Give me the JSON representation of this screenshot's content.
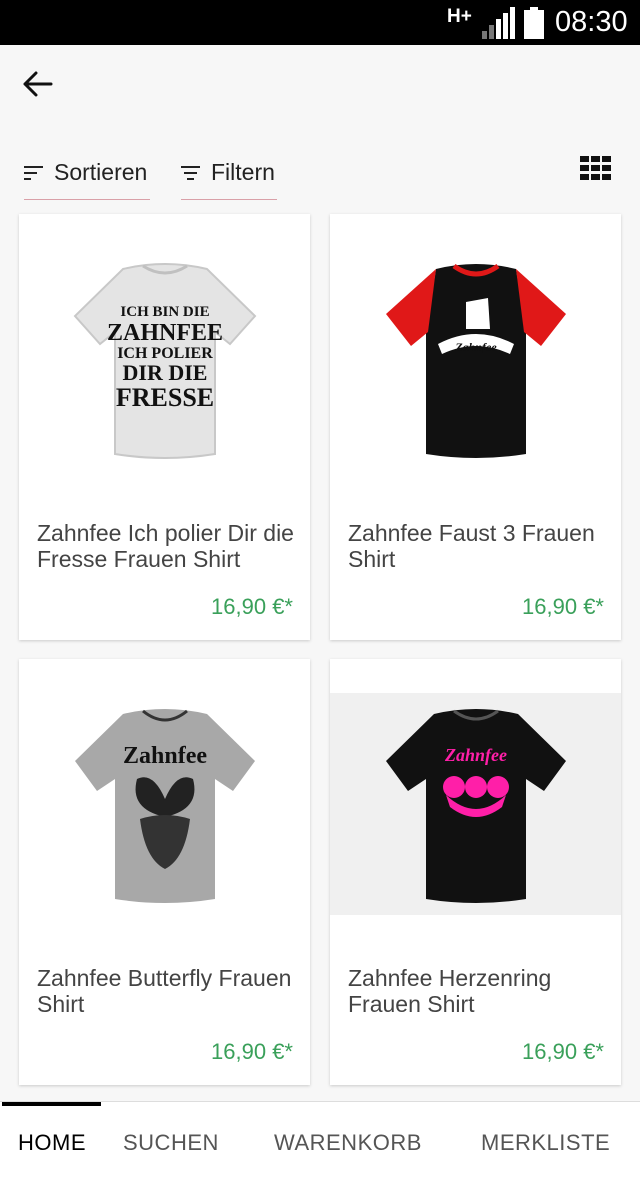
{
  "status_bar": {
    "network": "H+",
    "time": "08:30",
    "icons": [
      "signal-icon",
      "battery-icon"
    ]
  },
  "header": {
    "back_icon": "arrow-left-icon"
  },
  "toolbar": {
    "sort_label": "Sortieren",
    "filter_label": "Filtern",
    "view_toggle_icon": "grid-view-icon"
  },
  "products": [
    {
      "title": "Zahnfee Ich polier Dir die Fresse Frauen Shirt",
      "price": "16,90 €*",
      "shirt_text_lines": [
        "ICH BIN DIE",
        "ZAHNFEE",
        "ICH POLIER",
        "DIR DIE",
        "FRESSE"
      ]
    },
    {
      "title": "Zahnfee Faust 3 Frauen Shirt",
      "price": "16,90 €*",
      "shirt_text_lines": [
        "Zahnfee"
      ]
    },
    {
      "title": "Zahnfee Butterfly Frauen Shirt",
      "price": "16,90 €*",
      "shirt_text_lines": [
        "Zahnfee"
      ]
    },
    {
      "title": "Zahnfee Herzenring Frauen Shirt",
      "price": "16,90 €*",
      "shirt_text_lines": [
        "Zahnfee"
      ]
    }
  ],
  "bottom_nav": {
    "items": [
      "HOME",
      "SUCHEN",
      "WARENKORB",
      "MERKLISTE"
    ],
    "active": "HOME"
  },
  "colors": {
    "price": "#3aa05a",
    "accent_underline": "#d9a0a8",
    "status_bar": "#000000"
  }
}
